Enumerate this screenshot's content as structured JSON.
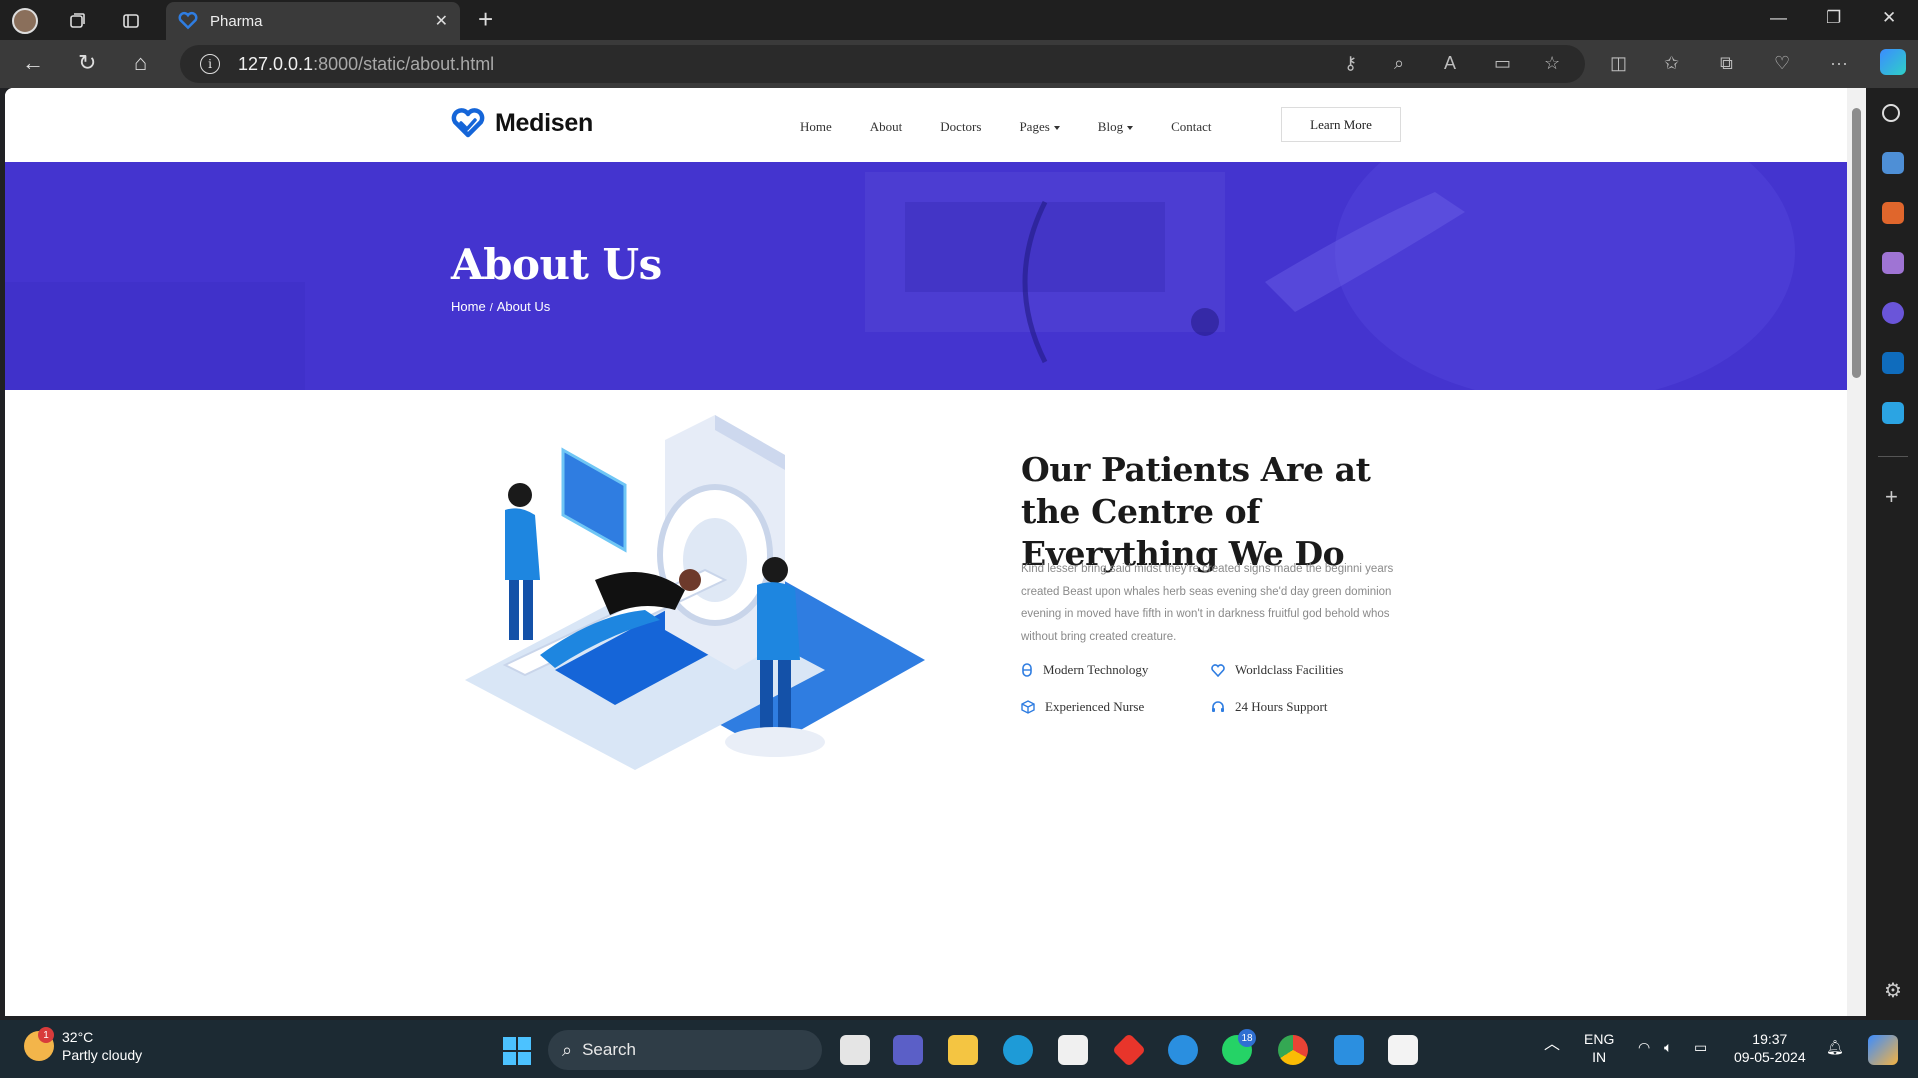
{
  "browser": {
    "tab_title": "Pharma",
    "url_host": "127.0.0.1",
    "url_path": ":8000/static/about.html"
  },
  "site": {
    "brand": "Medisen",
    "nav": [
      "Home",
      "About",
      "Doctors",
      "Pages",
      "Blog",
      "Contact"
    ],
    "cta": "Learn More"
  },
  "hero": {
    "title": "About Us",
    "breadcrumb_home": "Home",
    "breadcrumb_sep": "/",
    "breadcrumb_current": "About Us"
  },
  "about": {
    "title": "Our Patients Are at the Centre of Everything We Do",
    "text": "Kind lesser bring said midst they're created signs made the beginni years created Beast upon whales herb seas evening she'd day green dominion evening in moved have fifth in won't in darkness fruitful god behold whos without bring created creature.",
    "features": [
      {
        "label": "Modern Technology",
        "icon": "capsule-icon"
      },
      {
        "label": "Worldclass Facilities",
        "icon": "heart-icon"
      },
      {
        "label": "Experienced Nurse",
        "icon": "box-icon"
      },
      {
        "label": "24 Hours Support",
        "icon": "headset-icon"
      }
    ]
  },
  "taskbar": {
    "temperature": "32°C",
    "weather": "Partly cloudy",
    "weather_badge": "1",
    "search": "Search",
    "lang_top": "ENG",
    "lang_bottom": "IN",
    "time": "19:37",
    "date": "09-05-2024",
    "whatsapp_badge": "18"
  },
  "colors": {
    "brand_blue": "#1565d8",
    "hero_purple": "#4434cf",
    "accent_blue": "#2f7de1"
  }
}
